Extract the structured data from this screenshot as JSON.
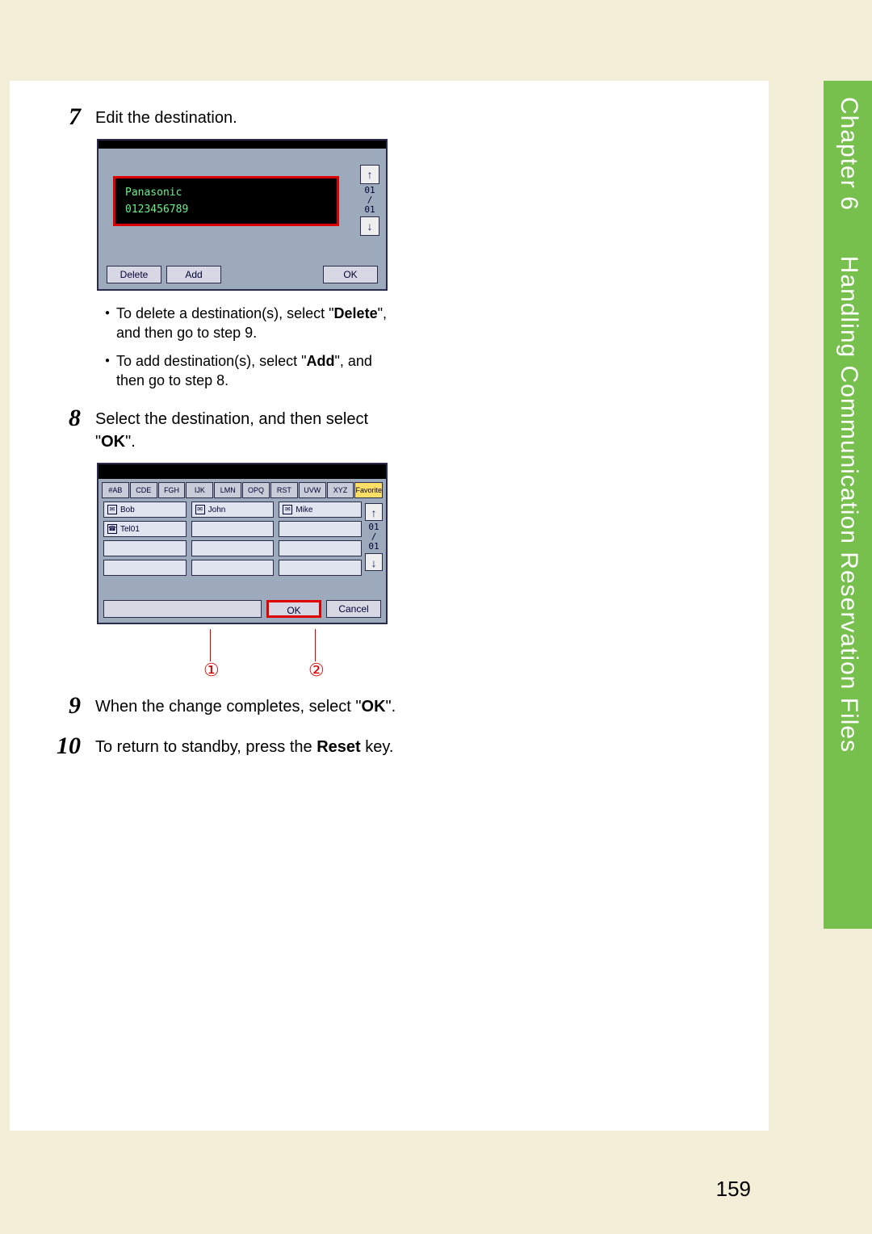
{
  "sidebar": {
    "chapter_label": "Chapter 6",
    "title": "Handling Communication Reservation Files"
  },
  "steps": {
    "s7": {
      "num": "7",
      "text": "Edit the destination.",
      "bullets": [
        {
          "pre": "To delete a destination(s), select \"",
          "bold": "Delete",
          "post": "\", and then go to step 9."
        },
        {
          "pre": "To add destination(s), select \"",
          "bold": "Add",
          "post": "\", and then go to step 8."
        }
      ]
    },
    "s8": {
      "num": "8",
      "pre": "Select the destination, and then select \"",
      "bold": "OK",
      "post": "\"."
    },
    "s9": {
      "num": "9",
      "pre": "When the change completes, select \"",
      "bold": "OK",
      "post": "\"."
    },
    "s10": {
      "num": "10",
      "pre": "To return to standby, press the ",
      "bold": "Reset",
      "post": " key."
    }
  },
  "shot1": {
    "dest_name": "Panasonic",
    "dest_number": "0123456789",
    "page_top": "01",
    "page_sep": "/",
    "page_bot": "01",
    "btn_delete": "Delete",
    "btn_add": "Add",
    "btn_ok": "OK"
  },
  "shot2": {
    "tabs": [
      "#AB",
      "CDE",
      "FGH",
      "IJK",
      "LMN",
      "OPQ",
      "RST",
      "UVW",
      "XYZ",
      "Favorite"
    ],
    "entries": {
      "bob": "Bob",
      "john": "John",
      "mike": "Mike",
      "tel01": "Tel01"
    },
    "page_top": "01",
    "page_sep": "/",
    "page_bot": "01",
    "btn_ok": "OK",
    "btn_cancel": "Cancel",
    "callout1": "①",
    "callout2": "②"
  },
  "page_number": "159"
}
